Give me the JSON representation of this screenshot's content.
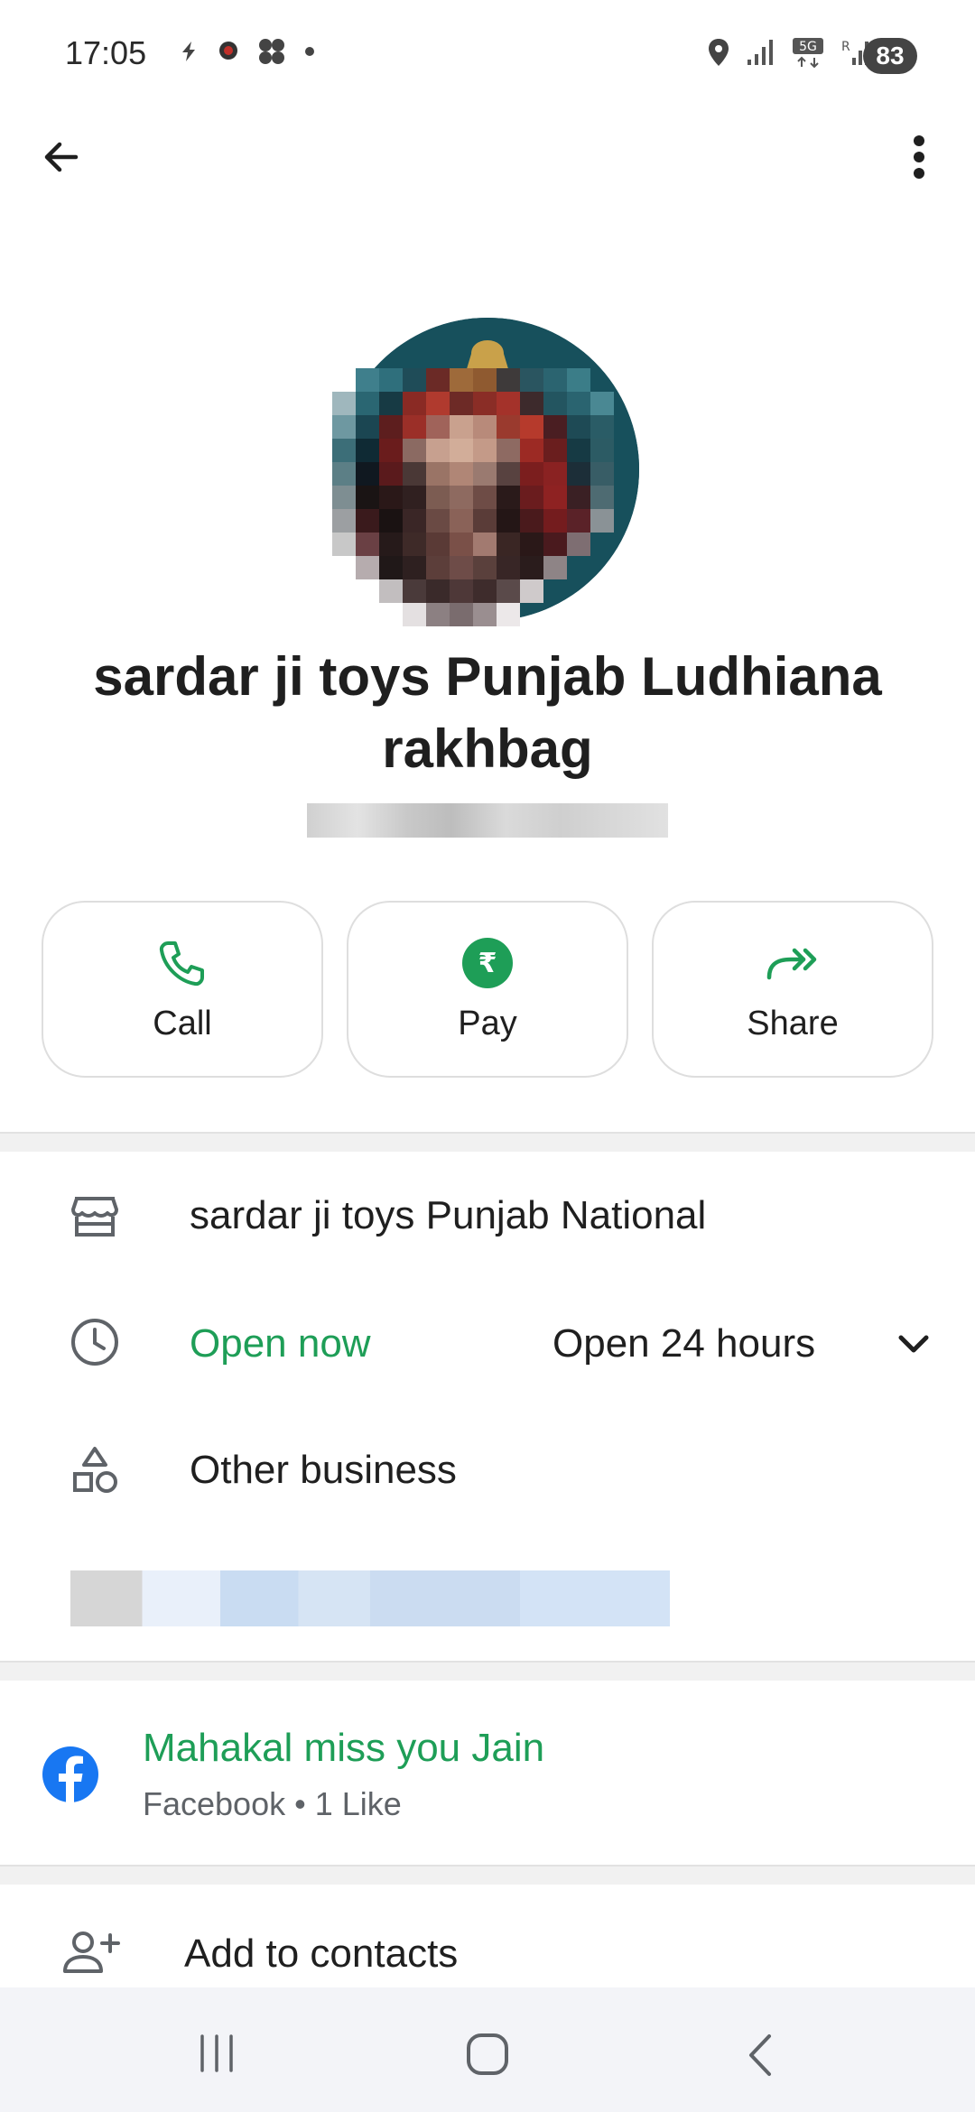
{
  "status_bar": {
    "time": "17:05",
    "battery": "83"
  },
  "header": {
    "back_icon": "arrow-left-icon",
    "menu_icon": "more-vert-icon"
  },
  "profile": {
    "name": "sardar ji toys Punjab Ludhiana rakhbag"
  },
  "actions": [
    {
      "label": "Call",
      "icon": "phone-icon"
    },
    {
      "label": "Pay",
      "icon": "rupee-icon"
    },
    {
      "label": "Share",
      "icon": "share-forward-icon"
    }
  ],
  "details": {
    "business_name": "sardar ji toys Punjab National",
    "open_status": "Open now",
    "hours": "Open 24 hours",
    "category": "Other business"
  },
  "facebook": {
    "title": "Mahakal miss you Jain",
    "subtitle": "Facebook • 1 Like"
  },
  "contacts": {
    "label": "Add to contacts"
  },
  "colors": {
    "accent_green": "#1e9e57",
    "facebook_blue": "#1877f2"
  }
}
